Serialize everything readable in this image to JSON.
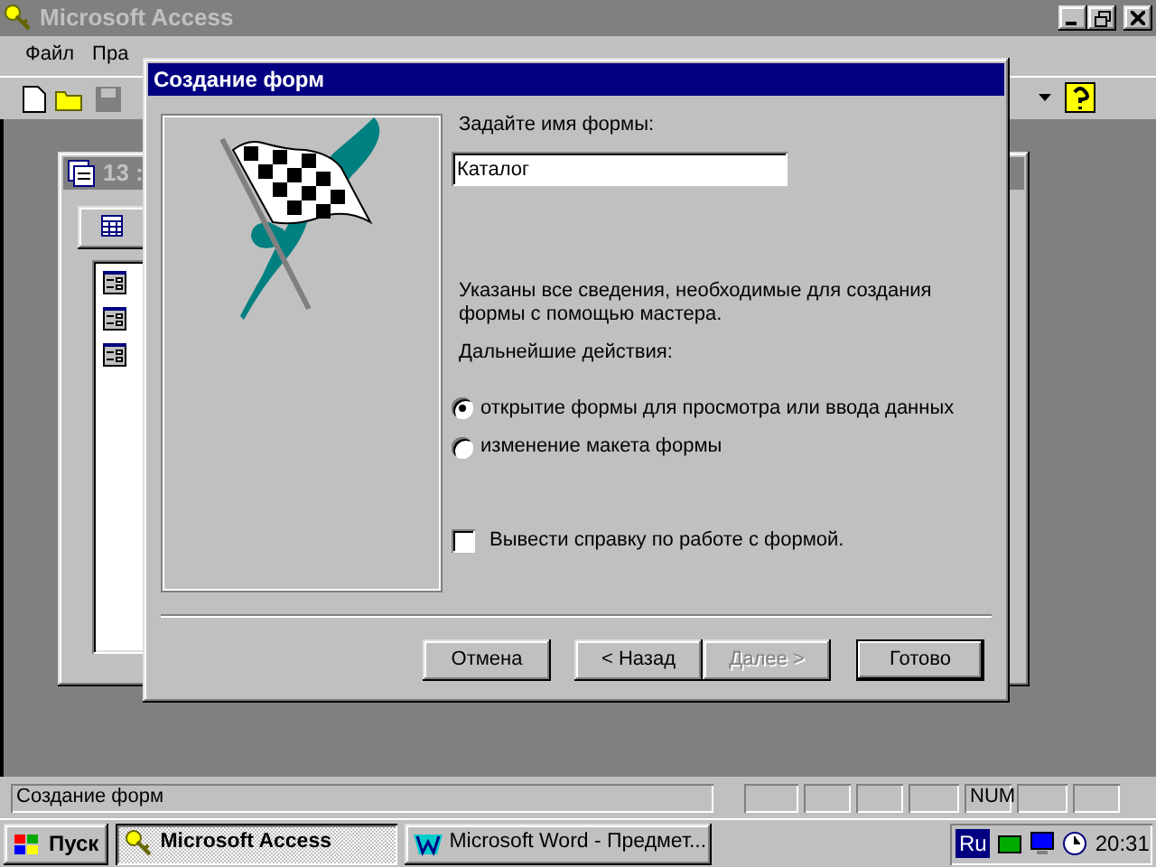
{
  "app_window": {
    "title": "Microsoft Access"
  },
  "menu": [
    {
      "label": "Файл"
    },
    {
      "label": "Пра"
    }
  ],
  "db_window": {
    "title": "13 :"
  },
  "dialog": {
    "title": "Создание форм",
    "name_label": "Задайте имя формы:",
    "name_value": "Каталог",
    "info": "Указаны все сведения, необходимые для создания формы с помощью мастера.",
    "next_label": "Дальнейшие действия:",
    "options": [
      {
        "label": "открытие формы для просмотра или ввода данных",
        "selected": true
      },
      {
        "label": "изменение макета формы",
        "selected": false
      }
    ],
    "help_checkbox": {
      "label": "Вывести справку по работе с формой.",
      "checked": false
    },
    "buttons": [
      {
        "label": "Отмена",
        "disabled": false,
        "default": false
      },
      {
        "label": "< Назад",
        "disabled": false,
        "default": false
      },
      {
        "label": "Далее >",
        "disabled": true,
        "default": false
      },
      {
        "label": "Готово",
        "disabled": false,
        "default": true
      }
    ]
  },
  "status_bar": {
    "text": "Создание форм",
    "num_indicator": "NUM"
  },
  "taskbar": {
    "start": "Пуск",
    "tasks": [
      {
        "label": "Microsoft Access",
        "selected": true
      },
      {
        "label": "Microsoft Word - Предмет...",
        "selected": false
      }
    ],
    "language": "Ru",
    "clock": "20:31"
  }
}
